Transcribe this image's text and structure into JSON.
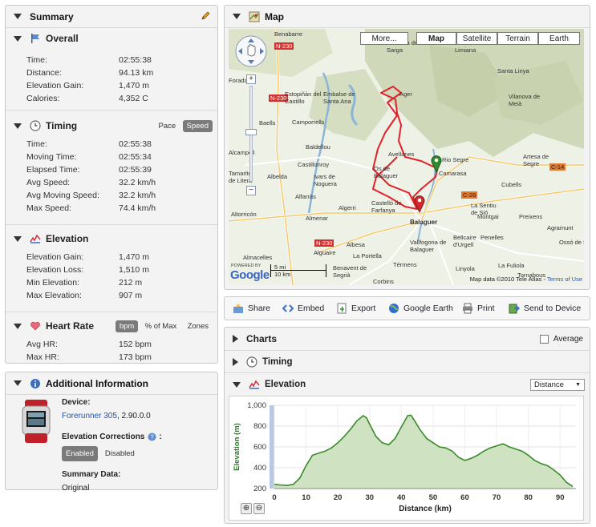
{
  "summary": {
    "title": "Summary",
    "overall": {
      "title": "Overall",
      "rows": [
        {
          "k": "Time:",
          "v": "02:55:38"
        },
        {
          "k": "Distance:",
          "v": "94.13 km"
        },
        {
          "k": "Elevation Gain:",
          "v": "1,470 m"
        },
        {
          "k": "Calories:",
          "v": "4,352 C"
        }
      ]
    },
    "timing": {
      "title": "Timing",
      "pace": "Pace",
      "speed": "Speed",
      "rows": [
        {
          "k": "Time:",
          "v": "02:55:38"
        },
        {
          "k": "Moving Time:",
          "v": "02:55:34"
        },
        {
          "k": "Elapsed Time:",
          "v": "02:55:39"
        },
        {
          "k": "Avg Speed:",
          "v": "32.2 km/h"
        },
        {
          "k": "Avg Moving Speed:",
          "v": "32.2 km/h"
        },
        {
          "k": "Max Speed:",
          "v": "74.4 km/h"
        }
      ]
    },
    "elevation": {
      "title": "Elevation",
      "rows": [
        {
          "k": "Elevation Gain:",
          "v": "1,470 m"
        },
        {
          "k": "Elevation Loss:",
          "v": "1,510 m"
        },
        {
          "k": "Min Elevation:",
          "v": "212 m"
        },
        {
          "k": "Max Elevation:",
          "v": "907 m"
        }
      ]
    },
    "heart": {
      "title": "Heart Rate",
      "bpm": "bpm",
      "pct": "% of Max",
      "zones": "Zones",
      "rows": [
        {
          "k": "Avg HR:",
          "v": "152 bpm"
        },
        {
          "k": "Max HR:",
          "v": "173 bpm"
        }
      ]
    }
  },
  "info": {
    "title": "Additional Information",
    "device_label": "Device:",
    "device_link": "Forerunner 305",
    "device_version": ", 2.90.0.0",
    "corrections_label": "Elevation Corrections",
    "enabled": "Enabled",
    "disabled": "Disabled",
    "summary_data_label": "Summary Data:",
    "summary_data_value": "Original"
  },
  "map": {
    "title": "Map",
    "more": "More...",
    "types": [
      "Map",
      "Satellite",
      "Terrain",
      "Earth"
    ],
    "scale_mi": "5 mi",
    "scale_km": "10 km",
    "powered": "POWERED BY",
    "google": "Google",
    "copyright": "Map data ©2010 Tele Atlas - ",
    "terms": "Terms of Use",
    "places": [
      {
        "t": "Benabarre"
      },
      {
        "t": "Os de Balaguer"
      },
      {
        "t": "Avellanes"
      },
      {
        "t": "Camporrells"
      },
      {
        "t": "Baells"
      },
      {
        "t": "Baldellou"
      },
      {
        "t": "Castillonroy"
      },
      {
        "t": "Alcampell"
      },
      {
        "t": "Tamarite de Litera"
      },
      {
        "t": "Albelda"
      },
      {
        "t": "Ivars de Noguera"
      },
      {
        "t": "Algerri"
      },
      {
        "t": "Alfarràs"
      },
      {
        "t": "Altorricón"
      },
      {
        "t": "Almenar"
      },
      {
        "t": "Balaguer"
      },
      {
        "t": "Castelló de Farfanya"
      },
      {
        "t": "Albesa"
      },
      {
        "t": "Alguaire"
      },
      {
        "t": "La Portella"
      },
      {
        "t": "Almacelles"
      },
      {
        "t": "Benavent de Segrià"
      },
      {
        "t": "Corbins"
      },
      {
        "t": "Térmens"
      },
      {
        "t": "Vallfogona de Balaguer"
      },
      {
        "t": "Bellcaire d'Urgell"
      },
      {
        "t": "Penelles"
      },
      {
        "t": "Linyola"
      },
      {
        "t": "La Fuliola"
      },
      {
        "t": "Tornabous"
      },
      {
        "t": "Montgai"
      },
      {
        "t": "Preixens"
      },
      {
        "t": "Agramunt"
      },
      {
        "t": "Ossó de Sió"
      },
      {
        "t": "Cubells"
      },
      {
        "t": "Artesa de Segre"
      },
      {
        "t": "Vilanova de Meià"
      },
      {
        "t": "Camarasa"
      },
      {
        "t": "Ager"
      },
      {
        "t": "Embalse de Santa Ana"
      },
      {
        "t": "Estopiñán del Castillo"
      },
      {
        "t": "Limiana"
      },
      {
        "t": "Rio Segre"
      },
      {
        "t": "La Sentiu de Sió"
      },
      {
        "t": "Foradada"
      },
      {
        "t": "Vilanova de la Sarga"
      },
      {
        "t": "Agramunt"
      },
      {
        "t": "Santa Linya"
      }
    ],
    "roads": [
      "N-230",
      "N-230",
      "N-230",
      "C-14",
      "C-26"
    ]
  },
  "toolbar": {
    "share": "Share",
    "embed": "Embed",
    "export": "Export",
    "google_earth": "Google Earth",
    "print": "Print",
    "send": "Send to Device"
  },
  "charts": {
    "title": "Charts",
    "average": "Average",
    "timing": "Timing",
    "elevation": "Elevation",
    "dropdown": "Distance"
  },
  "chart_data": {
    "type": "area",
    "xlabel": "Distance (km)",
    "ylabel": "Elevation (m)",
    "xlim": [
      0,
      95
    ],
    "ylim": [
      200,
      1000
    ],
    "xticks": [
      0,
      10,
      20,
      30,
      40,
      50,
      60,
      70,
      80,
      90
    ],
    "yticks": [
      200,
      400,
      600,
      800,
      1000
    ],
    "ytick_labels": [
      "200",
      "400",
      "600",
      "800",
      "1,000"
    ],
    "x": [
      0,
      2,
      4,
      6,
      8,
      10,
      12,
      14,
      16,
      18,
      20,
      22,
      24,
      26,
      28,
      29,
      30,
      32,
      34,
      36,
      38,
      40,
      42,
      43,
      44,
      46,
      48,
      50,
      52,
      54,
      56,
      58,
      60,
      62,
      64,
      66,
      68,
      70,
      72,
      74,
      76,
      78,
      80,
      82,
      84,
      86,
      88,
      90,
      92,
      94
    ],
    "y": [
      240,
      235,
      230,
      240,
      300,
      420,
      520,
      540,
      560,
      590,
      640,
      700,
      770,
      850,
      900,
      880,
      820,
      700,
      640,
      620,
      680,
      790,
      900,
      905,
      860,
      760,
      680,
      640,
      600,
      590,
      560,
      500,
      470,
      490,
      520,
      560,
      590,
      610,
      630,
      600,
      580,
      560,
      520,
      470,
      440,
      420,
      380,
      330,
      260,
      220
    ],
    "color": "#3a8a2a",
    "fill": "#cfe3c3"
  }
}
